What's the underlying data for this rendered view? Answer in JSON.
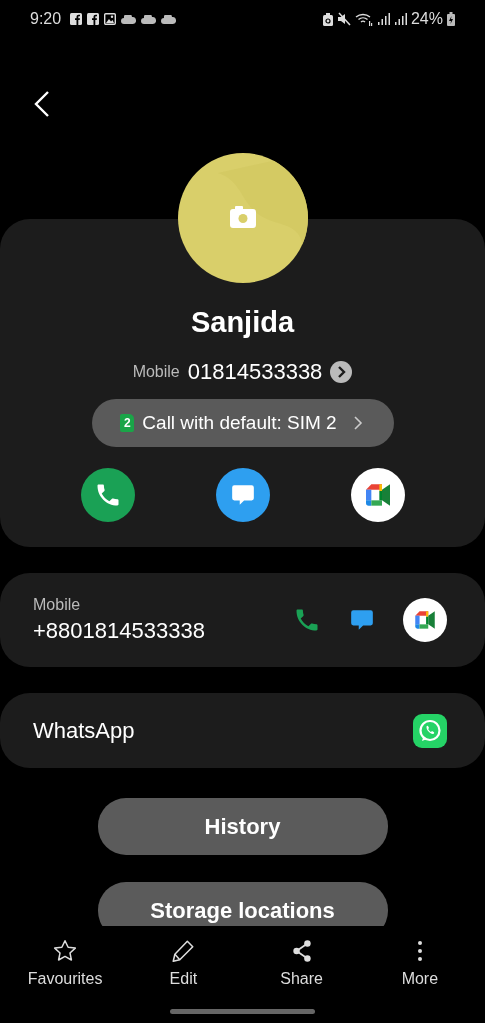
{
  "status_bar": {
    "time": "9:20",
    "battery": "24%"
  },
  "contact": {
    "name": "Sanjida",
    "number_label": "Mobile",
    "number": "01814533338",
    "sim_badge": "2",
    "sim_label": "Call with default: SIM 2"
  },
  "phone_entry": {
    "label": "Mobile",
    "number": "+8801814533338"
  },
  "apps": [
    {
      "label": "WhatsApp"
    }
  ],
  "buttons": [
    "History",
    "Storage locations"
  ],
  "bottom_nav": [
    {
      "label": "Favourites"
    },
    {
      "label": "Edit"
    },
    {
      "label": "Share"
    },
    {
      "label": "More"
    }
  ]
}
